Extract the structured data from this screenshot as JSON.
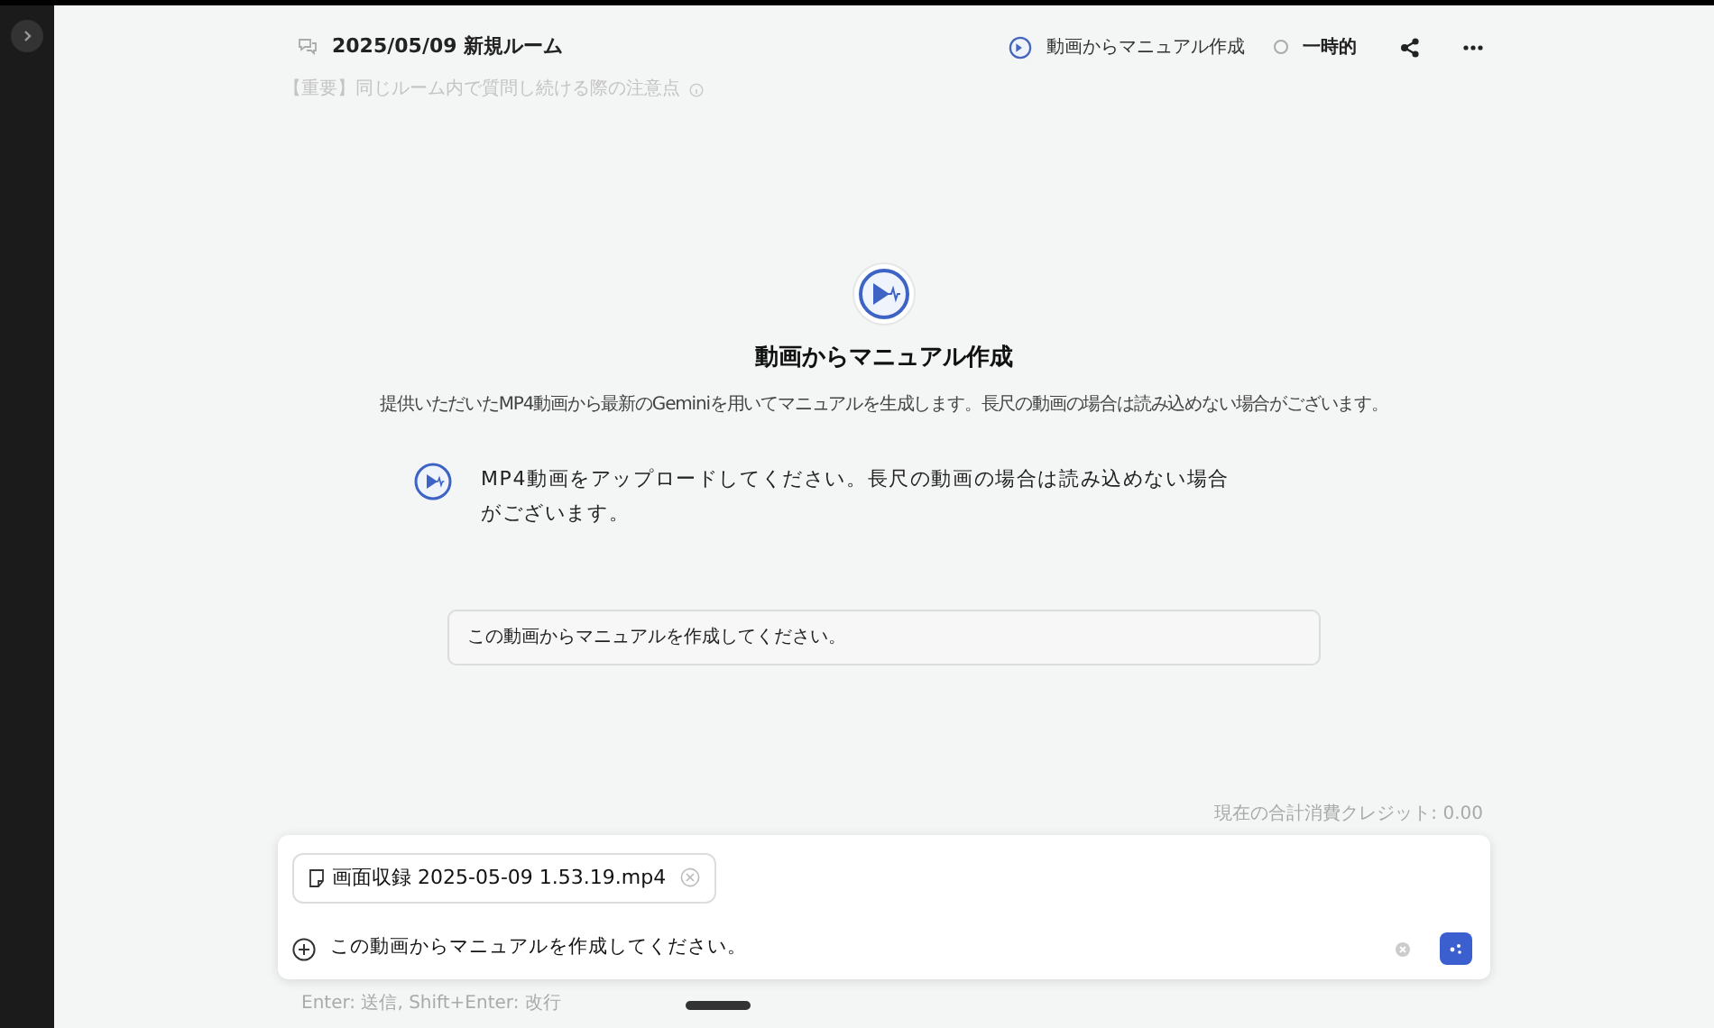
{
  "sidebar": {
    "expanded": false
  },
  "header": {
    "room_title": "2025/05/09 新規ルーム",
    "notice": "【重要】同じルーム内で質問し続ける際の注意点",
    "mode": "動画からマニュアル作成",
    "temporary": {
      "label": "一時的",
      "checked": false
    }
  },
  "intro": {
    "title": "動画からマニュアル作成",
    "description": "提供いただいたMP4動画から最新のGeminiを用いてマニュアルを生成します。長尺の動画の場合は読み込めない場合がございます。"
  },
  "messages": [
    {
      "kind": "assistant",
      "text": "MP4動画をアップロードしてください。長尺の動画の場合は読み込めない場合がございます。"
    },
    {
      "kind": "user",
      "text": "この動画からマニュアルを作成してください。"
    }
  ],
  "credits": "現在の合計消費クレジット: 0.00",
  "composer": {
    "attachment": "画面収録 2025-05-09 1.53.19.mp4",
    "value": "この動画からマニュアルを作成してください。",
    "hint": "Enter: 送信, Shift+Enter: 改行"
  }
}
